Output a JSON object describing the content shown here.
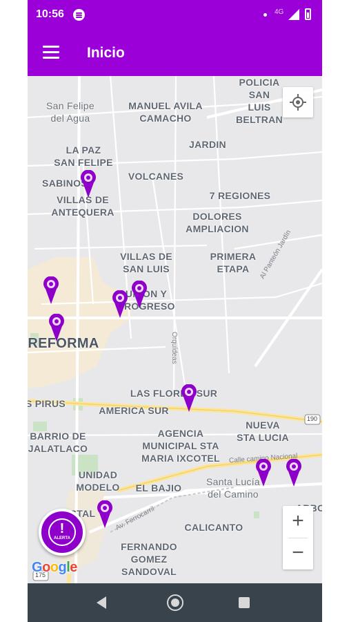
{
  "status_bar": {
    "time": "10:56",
    "network": "4G"
  },
  "app_bar": {
    "title": "Inicio"
  },
  "map": {
    "labels": [
      "POLICIA SAN\nLUIS BELTRAN",
      "San Felipe\ndel Agua",
      "MANUEL AVILA\nCAMACHO",
      "JARDIN",
      "LA PAZ\nSAN FELIPE",
      "VOLCANES",
      "SABINOS",
      "VILLAS DE\nANTEQUERA",
      "7 REGIONES",
      "DOLORES\nAMPLIACION",
      "PRIMERA\nETAPA",
      "VILLAS DE\nSAN LUIS",
      "UNION Y\nPROGRESO",
      "REFORMA",
      "LAS FLORES SUR",
      "S PIRUS",
      "AMERICA SUR",
      "BARRIO DE\nJALATLACO",
      "AGENCIA\nMUNICIPAL STA\nMARIA IXCOTEL",
      "NUEVA\nSTA LUCIA",
      "UNIDAD\nMODELO",
      "EL BAJIO",
      "Santa Lucía\ndel Camino",
      "ARBO",
      "STAL",
      "CALICANTO",
      "FERNANDO\nGOMEZ\nSANDOVAL"
    ],
    "streets": [
      "Al Panteón Jardín",
      "Orquídeas",
      "Calle camino Nacional",
      "Av. Ferrocarril",
      "190",
      "175"
    ],
    "marker_count": 9,
    "google_logo": "Google"
  },
  "alert_button": {
    "label": "ALERTA",
    "symbol": "!"
  },
  "zoom": {
    "in": "+",
    "out": "−"
  },
  "colors": {
    "primary": "#9b00d9",
    "marker": "#8e00c9",
    "nav": "#39434b"
  }
}
